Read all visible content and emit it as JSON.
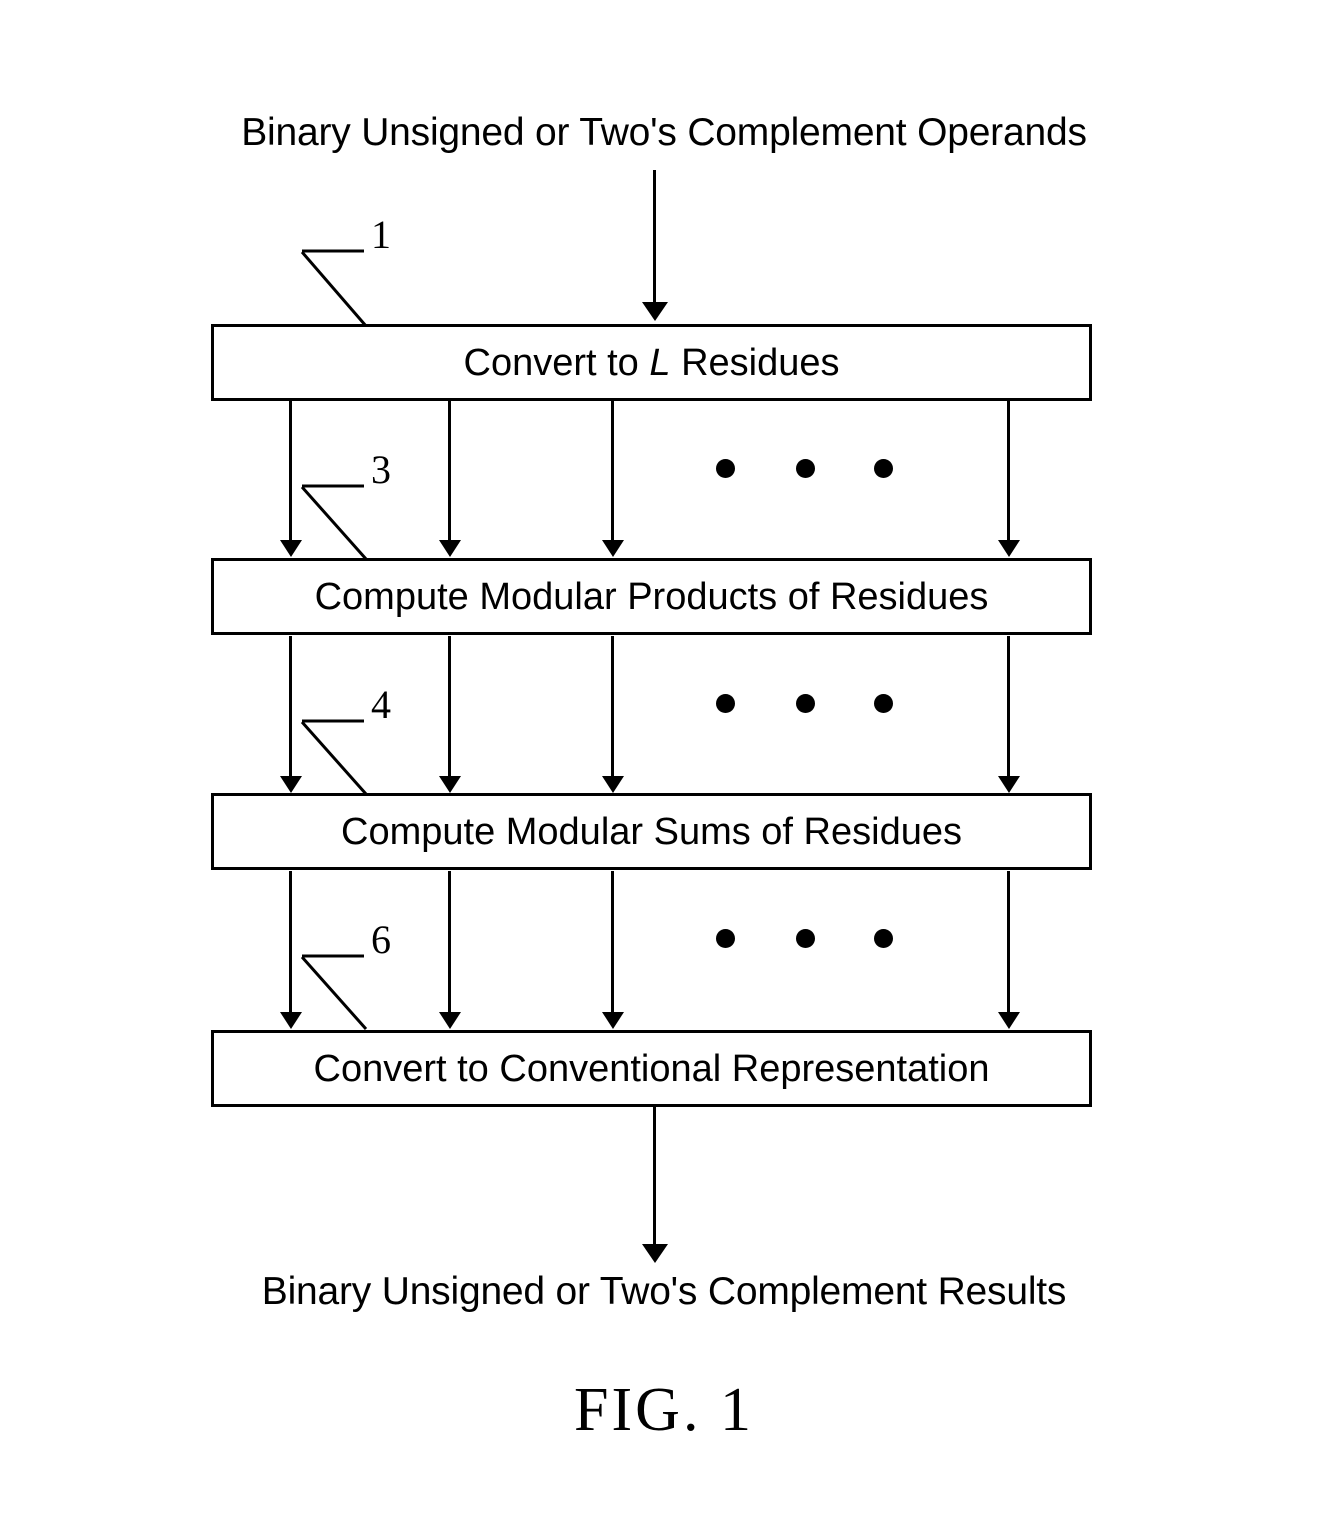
{
  "figure": {
    "caption": "FIG. 1",
    "input_label": "Binary Unsigned or Two's Complement Operands",
    "output_label": "Binary Unsigned or Two's Complement Results"
  },
  "boxes": [
    {
      "id": "box-1",
      "reference_numeral": "1",
      "label_prefix": "Convert to ",
      "label_italic": "L",
      "label_suffix": " Residues",
      "label_plain": "Convert to L Residues"
    },
    {
      "id": "box-2",
      "reference_numeral": "3",
      "label_prefix": "Compute Modular Products of Residues",
      "label_italic": "",
      "label_suffix": "",
      "label_plain": "Compute Modular Products of Residues"
    },
    {
      "id": "box-3",
      "reference_numeral": "4",
      "label_prefix": "Compute Modular Sums of Residues",
      "label_italic": "",
      "label_suffix": "",
      "label_plain": "Compute Modular Sums of Residues"
    },
    {
      "id": "box-4",
      "reference_numeral": "6",
      "label_prefix": "Convert to Conventional Representation",
      "label_italic": "",
      "label_suffix": "",
      "label_plain": "Convert to Conventional Representation"
    }
  ],
  "connectors": {
    "parallel_bus_arrow_count": 4,
    "ellipsis_dot_count": 3,
    "ellipsis_meaning": "continues for L parallel residue channels"
  },
  "colors": {
    "ink": "#000000",
    "paper": "#ffffff"
  }
}
